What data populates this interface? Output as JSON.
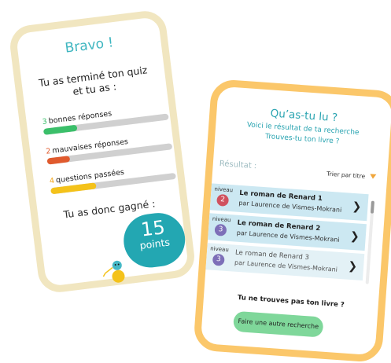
{
  "quiz_card": {
    "title": "Bravo !",
    "line1": "Tu as terminé ton quiz",
    "line2": "et tu as :",
    "stats": [
      {
        "num": "3",
        "label": "bonnes réponses",
        "color": "#3bbf6a",
        "fraction": 0.27
      },
      {
        "num": "2",
        "label": "mauvaises réponses",
        "color": "#e05a2d",
        "fraction": 0.18
      },
      {
        "num": "4",
        "label": "questions passées",
        "color": "#f4c21a",
        "fraction": 0.36
      }
    ],
    "won_text": "Tu as donc gagné :",
    "points_value": "15",
    "points_label": "points",
    "mascot_icon": "mascot-icon"
  },
  "search_card": {
    "title": "Qu’as-tu lu ?",
    "subtitle1": "Voici le résultat de ta recherche",
    "subtitle2": "Trouves-tu ton livre ?",
    "result_label": "Résultat :",
    "sort_label": "Trier par titre",
    "results": [
      {
        "level_label": "niveau",
        "level": "2",
        "level_color": "#d0525f",
        "title": "Le roman de Renard 1",
        "author": "par Laurence de Vismes-Mokrani"
      },
      {
        "level_label": "niveau",
        "level": "3",
        "level_color": "#7d6fb8",
        "title": "Le roman de Renard 2",
        "author": "par Laurence de Vismes-Mokrani"
      },
      {
        "level_label": "niveau",
        "level": "3",
        "level_color": "#7d6fb8",
        "title": "Le roman de Renard 3",
        "author": "par Laurence de Vismes-Mokrani"
      }
    ],
    "not_found": "Tu ne trouves pas ton livre ?",
    "new_search_button": "Faire une autre recherche"
  }
}
